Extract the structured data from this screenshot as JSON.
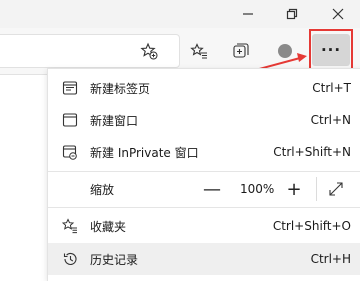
{
  "toolbar": {
    "more_label": "···",
    "icons": [
      "add-to-favorites-icon",
      "favorites-icon",
      "collections-icon",
      "profile-icon"
    ]
  },
  "window": {
    "minimize_icon": "minimize-icon",
    "restore_icon": "restore-icon",
    "close_icon": "close-icon"
  },
  "annotation": {
    "color": "#e53935"
  },
  "menu": {
    "new_tab": {
      "label": "新建标签页",
      "shortcut": "Ctrl+T"
    },
    "new_window": {
      "label": "新建窗口",
      "shortcut": "Ctrl+N"
    },
    "new_inprivate": {
      "label": "新建 InPrivate 窗口",
      "shortcut": "Ctrl+Shift+N"
    },
    "zoom": {
      "label": "缩放",
      "minus": "—",
      "value": "100%",
      "plus": "+"
    },
    "favorites": {
      "label": "收藏夹",
      "shortcut": "Ctrl+Shift+O"
    },
    "history": {
      "label": "历史记录",
      "shortcut": "Ctrl+H"
    }
  }
}
